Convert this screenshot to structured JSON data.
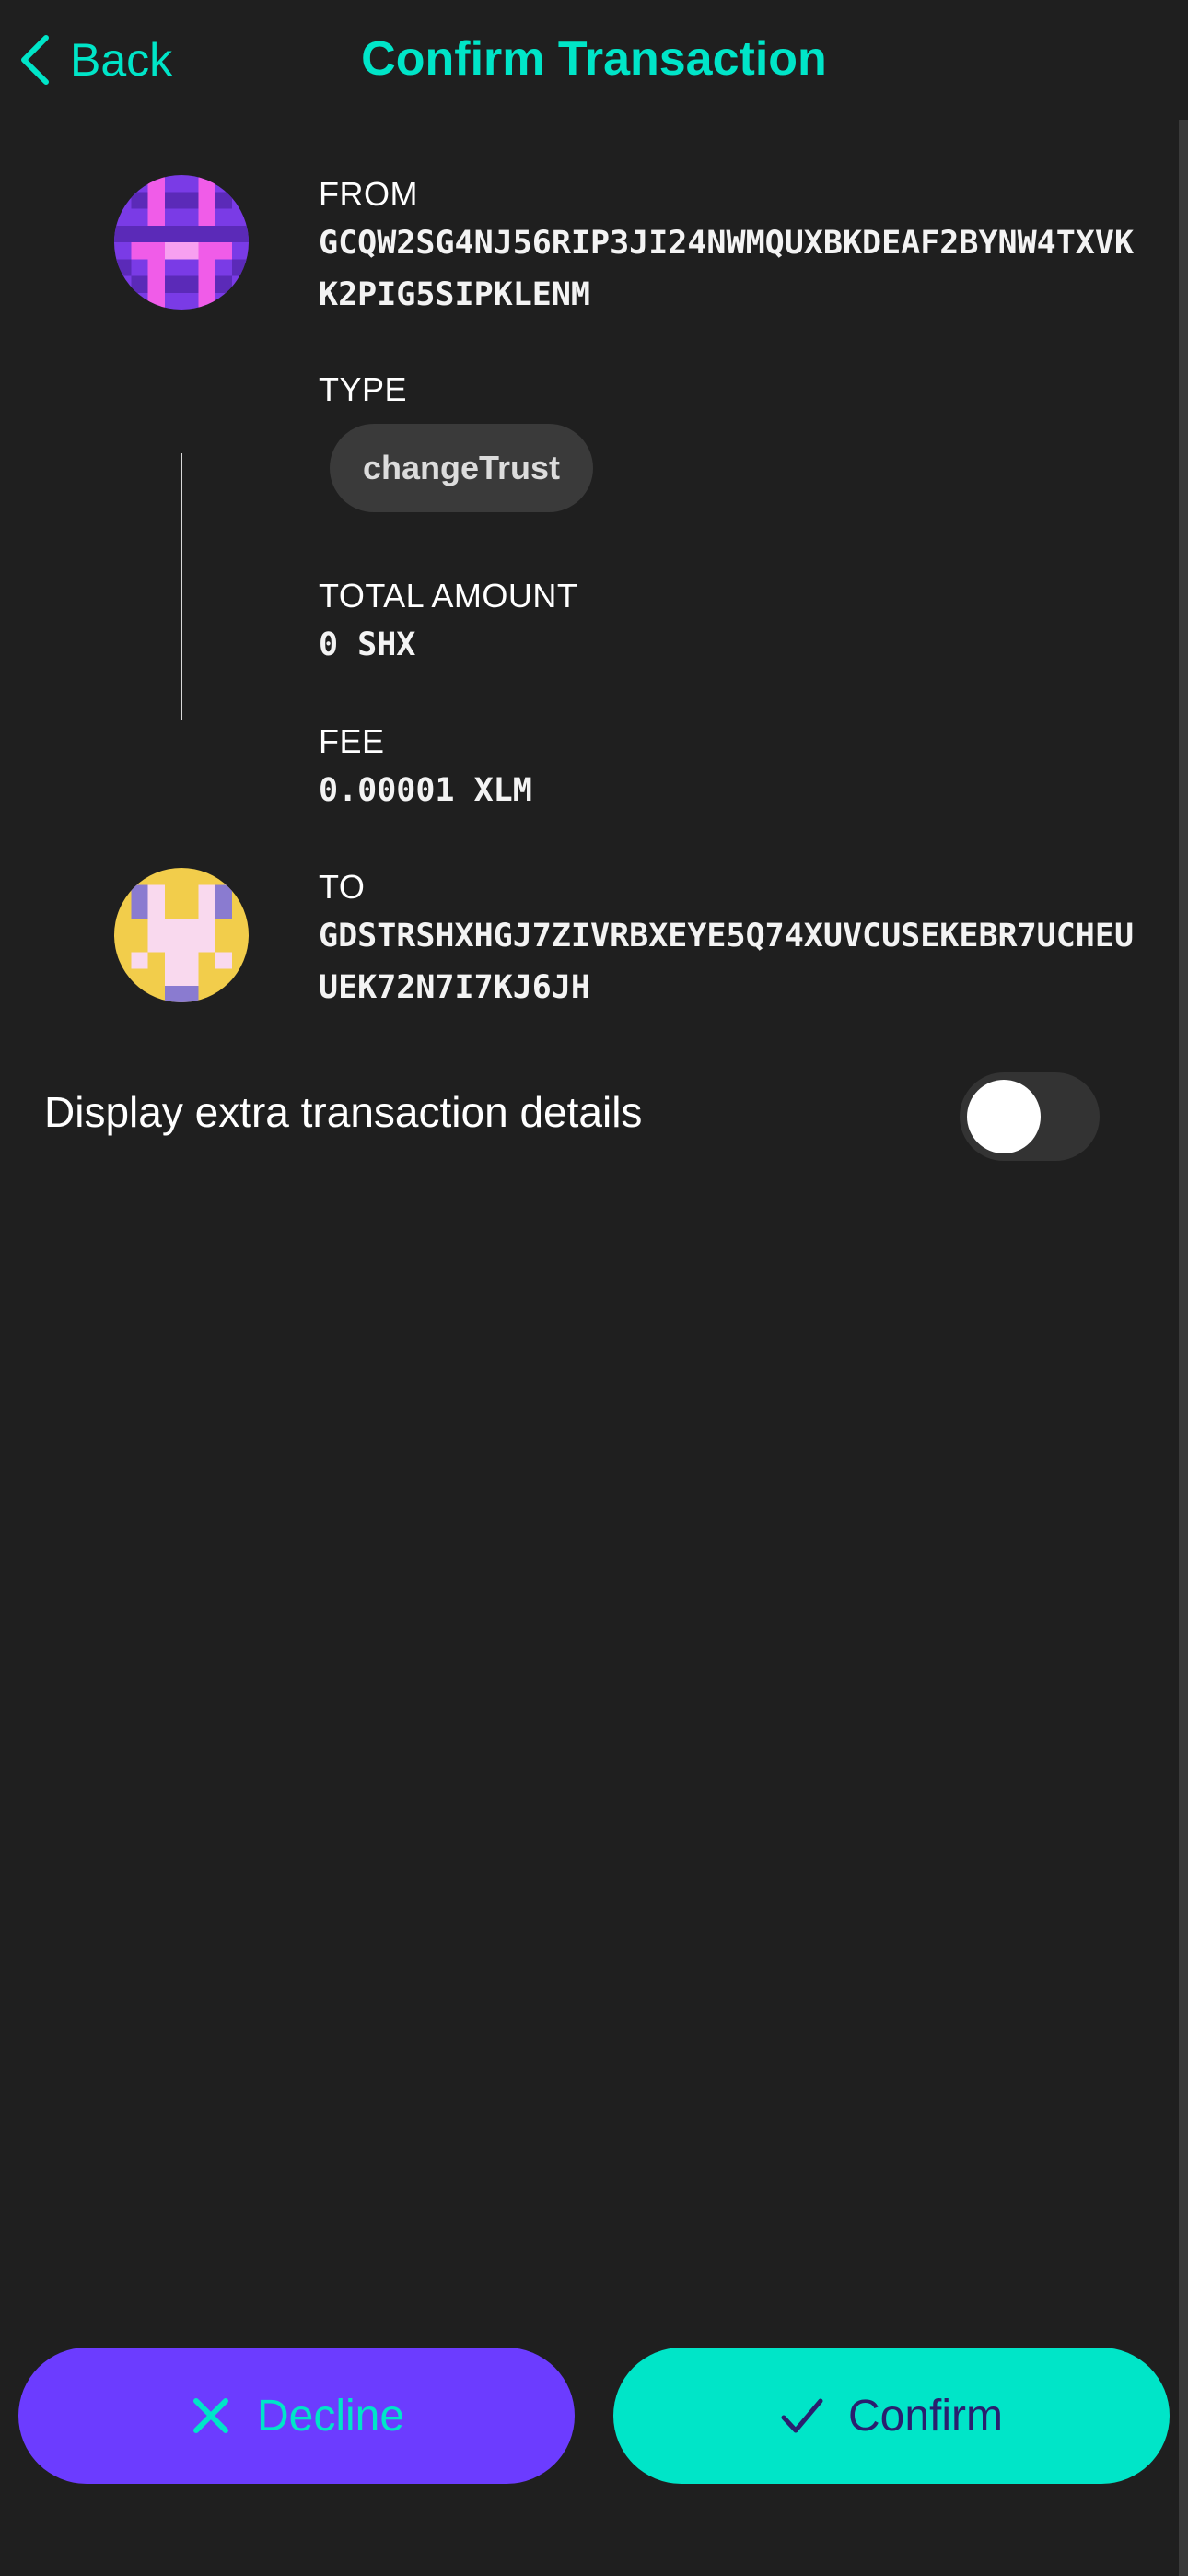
{
  "header": {
    "back_label": "Back",
    "title": "Confirm Transaction"
  },
  "transaction": {
    "from_label": "FROM",
    "from_address": "GCQW2SG4NJ56RIP3JI24NWMQUXBKDEAF2BYNW4TXVKK2PIG5SIPKLENM",
    "type_label": "TYPE",
    "type_value": "changeTrust",
    "total_label": "TOTAL AMOUNT",
    "total_value": "0 SHX",
    "fee_label": "FEE",
    "fee_value": "0.00001 XLM",
    "to_label": "TO",
    "to_address": "GDSTRSHXHGJ7ZIVRBXEYE5Q74XUVCUSEKEBR7UCHEUUEK72N7I7KJ6JH"
  },
  "extra_details": {
    "label": "Display extra transaction details",
    "enabled": false
  },
  "actions": {
    "decline_label": "Decline",
    "confirm_label": "Confirm"
  },
  "colors": {
    "background": "#1f1f1f",
    "accent": "#00e5c8",
    "decline_bg": "#6c3cff",
    "confirm_text": "#2a1f6e"
  }
}
